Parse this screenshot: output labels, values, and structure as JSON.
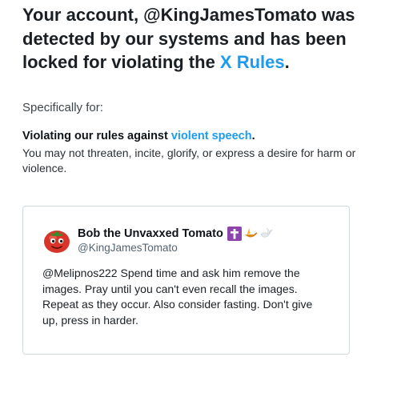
{
  "notice": {
    "headline_prefix": "Your account, @KingJamesTomato was detected by our systems and has been locked for violating the ",
    "rules_link": "X Rules",
    "headline_suffix": "."
  },
  "specifics": {
    "intro": "Specifically for:",
    "rule_prefix": "Violating our rules against ",
    "rule_link": "violent speech",
    "rule_suffix": ".",
    "rule_description": "You may not threaten, incite, glorify, or express a desire for harm or violence."
  },
  "tweet": {
    "display_name": "Bob the Unvaxxed Tomato",
    "handle": "@KingJamesTomato",
    "name_emojis": [
      "latin-cross-emoji",
      "oil-lamp-emoji",
      "dove-emoji"
    ],
    "text": "@Melipnos222 Spend time and ask him remove the images. Pray until you can't even recall the images. Repeat as they occur. Also consider fasting. Don't give up, press in harder."
  },
  "colors": {
    "link": "#1d9bf0",
    "text": "#0f1419",
    "secondary": "#536471",
    "border": "#cfd9de"
  }
}
